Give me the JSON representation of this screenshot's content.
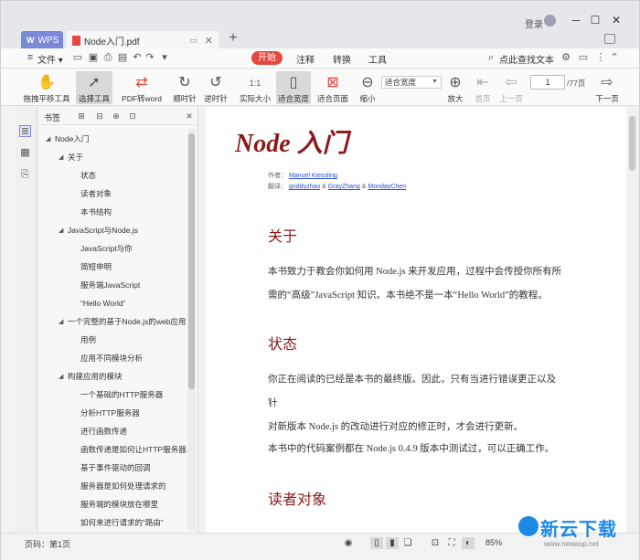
{
  "window": {
    "login_label": "登录",
    "min_btn": "─",
    "max_btn": "☐",
    "close_btn": "✕"
  },
  "tabs": {
    "wps_label": "WPS",
    "doc_label": "Node入门.pdf",
    "doc_close": "✕",
    "new_tab": "+"
  },
  "menu": {
    "file_label": "文件",
    "file_caret": "▾",
    "tabs": [
      "开始",
      "注释",
      "转换",
      "工具"
    ],
    "search_label": "点此查找文本"
  },
  "toolbar": {
    "hand": "拖拽平移工具",
    "select": "选择工具",
    "pdf2word": "PDF转word",
    "rotate_cw": "顺时针",
    "rotate_ccw": "逆时针",
    "actual_size": "实际大小",
    "fit_width": "适合宽度",
    "fit_page": "适合页面",
    "zoom_out": "缩小",
    "zoom_select": "适合宽度",
    "zoom_in": "放大",
    "first_page": "首页",
    "prev_page": "上一页",
    "page_current": "1",
    "page_total": "/77页",
    "next_page": "下一页"
  },
  "outline": {
    "title": "书签",
    "items": [
      {
        "label": "Node入门",
        "level": 0,
        "expanded": true
      },
      {
        "label": "关于",
        "level": 1,
        "expanded": true
      },
      {
        "label": "状态",
        "level": 2
      },
      {
        "label": "读者对象",
        "level": 2
      },
      {
        "label": "本书结构",
        "level": 2
      },
      {
        "label": "JavaScript与Node.js",
        "level": 1,
        "expanded": true
      },
      {
        "label": "JavaScript与你",
        "level": 2
      },
      {
        "label": "简短申明",
        "level": 2
      },
      {
        "label": "服务端JavaScript",
        "level": 2
      },
      {
        "label": "“Hello World”",
        "level": 2
      },
      {
        "label": "一个完整的基于Node.js的web应用",
        "level": 1,
        "expanded": true
      },
      {
        "label": "用例",
        "level": 2
      },
      {
        "label": "应用不同模块分析",
        "level": 2
      },
      {
        "label": "构建应用的模块",
        "level": 1,
        "expanded": true
      },
      {
        "label": "一个基础的HTTP服务器",
        "level": 2
      },
      {
        "label": "分析HTTP服务器",
        "level": 2
      },
      {
        "label": "进行函数传递",
        "level": 2
      },
      {
        "label": "函数传递是如何让HTTP服务器...",
        "level": 2
      },
      {
        "label": "基于事件驱动的回调",
        "level": 2
      },
      {
        "label": "服务器是如何处理请求的",
        "level": 2
      },
      {
        "label": "服务端的模块放在哪里",
        "level": 2
      },
      {
        "label": "如何来进行请求的“路由”",
        "level": 2
      }
    ]
  },
  "document": {
    "title": "Node 入门",
    "author_label": "作者：",
    "author": "Manuel Kiessling",
    "translator_label": "翻译：",
    "translator1": "goddyzhao",
    "amp": "&",
    "translator2": "GrayZhang",
    "translator3": "MondayChen",
    "sec_about": "关于",
    "about_line1": "本书致力于教会你如何用 Node.js 来开发应用，过程中会传授你所有所",
    "about_line2": "需的“高级”JavaScript 知识。本书绝不是一本“Hello World”的教程。",
    "sec_status": "状态",
    "status_line1": "你正在阅读的已经是本书的最终版。因此，只有当进行错误更正以及针",
    "status_line2": "对新版本 Node.js 的改动进行对应的修正时，才会进行更新。",
    "status_line3": "本书中的代码案例都在 Node.js 0.4.9 版本中测试过，可以正确工作。",
    "sec_readers": "读者对象"
  },
  "status": {
    "page_label": "页码：第1页",
    "zoom_value": "85%"
  },
  "watermark": {
    "cn": "新云下载",
    "url": "www.newasp.net"
  },
  "colors": {
    "accent_red": "#e8453c",
    "title_red": "#8b1a1a",
    "link_blue": "#2a4ecb",
    "wps_tab": "#7a8ad8"
  }
}
